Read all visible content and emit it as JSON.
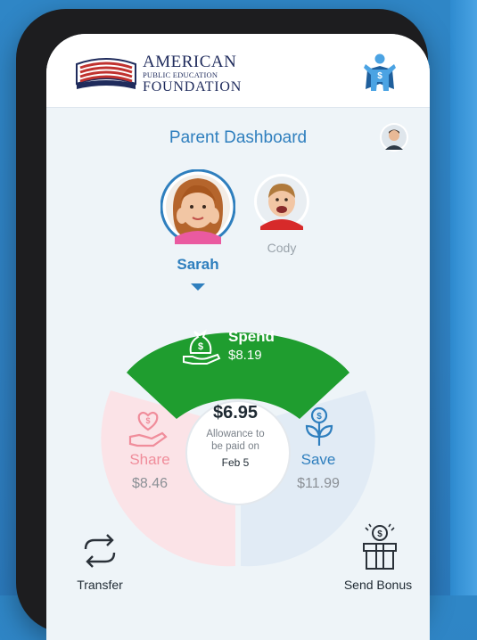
{
  "header": {
    "logo": {
      "line1": "AMERICAN",
      "line2": "PUBLIC EDUCATION",
      "line3": "FOUNDATION"
    },
    "hero_icon": "superhero-icon"
  },
  "page": {
    "title": "Parent Dashboard"
  },
  "children": [
    {
      "name": "Sarah",
      "selected": true
    },
    {
      "name": "Cody",
      "selected": false
    }
  ],
  "wheel": {
    "spend": {
      "label": "Spend",
      "amount": "$8.19",
      "color": "#1f9d2f",
      "icon": "money-bag-hand-icon"
    },
    "share": {
      "label": "Share",
      "amount": "$8.46",
      "color": "#f08d9b",
      "icon": "heart-hand-icon"
    },
    "save": {
      "label": "Save",
      "amount": "$11.99",
      "color": "#2f7fbe",
      "icon": "money-plant-icon"
    },
    "center": {
      "amount": "$6.95",
      "note_line1": "Allowance to",
      "note_line2": "be paid on",
      "date": "Feb 5"
    }
  },
  "actions": {
    "transfer": {
      "label": "Transfer",
      "icon": "transfer-arrows-icon"
    },
    "bonus": {
      "label": "Send Bonus",
      "icon": "gift-box-icon"
    }
  },
  "colors": {
    "accent_blue": "#2f7fbe",
    "spend_green": "#1f9d2f",
    "share_pink": "#f08d9b",
    "background": "#2f86c6"
  }
}
